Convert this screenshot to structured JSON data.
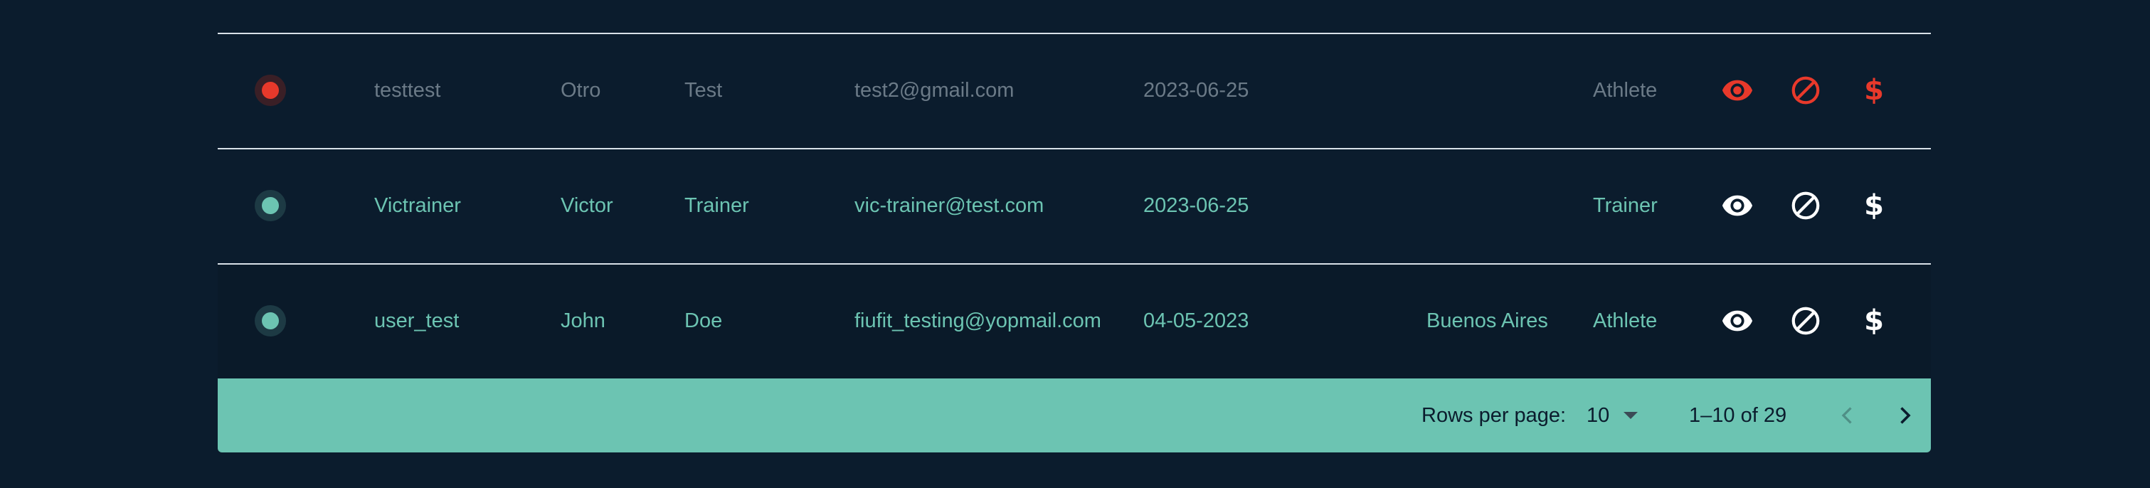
{
  "table": {
    "rows": [
      {
        "status": "inactive",
        "username": "testtest",
        "first_name": "Otro",
        "last_name": "Test",
        "email": "test2@gmail.com",
        "date": "2023-06-25",
        "location": "",
        "role": "Athlete"
      },
      {
        "status": "active",
        "username": "Victrainer",
        "first_name": "Victor",
        "last_name": "Trainer",
        "email": "vic-trainer@test.com",
        "date": "2023-06-25",
        "location": "",
        "role": "Trainer"
      },
      {
        "status": "active",
        "username": "user_test",
        "first_name": "John",
        "last_name": "Doe",
        "email": "fiufit_testing@yopmail.com",
        "date": "04-05-2023",
        "location": "Buenos Aires",
        "role": "Athlete"
      }
    ],
    "action_icons": [
      "eye-icon",
      "block-icon",
      "dollar-icon"
    ],
    "dollar_glyph": "$"
  },
  "pagination": {
    "rows_per_page_label": "Rows per page:",
    "rows_per_page_value": "10",
    "range_label": "1–10 of 29"
  },
  "colors": {
    "background": "#0b1c2d",
    "accent_teal": "#6cc4b2",
    "inactive_red": "#e8392b",
    "muted_text": "#6b7a87",
    "footer_bg": "#6cc4b2"
  }
}
